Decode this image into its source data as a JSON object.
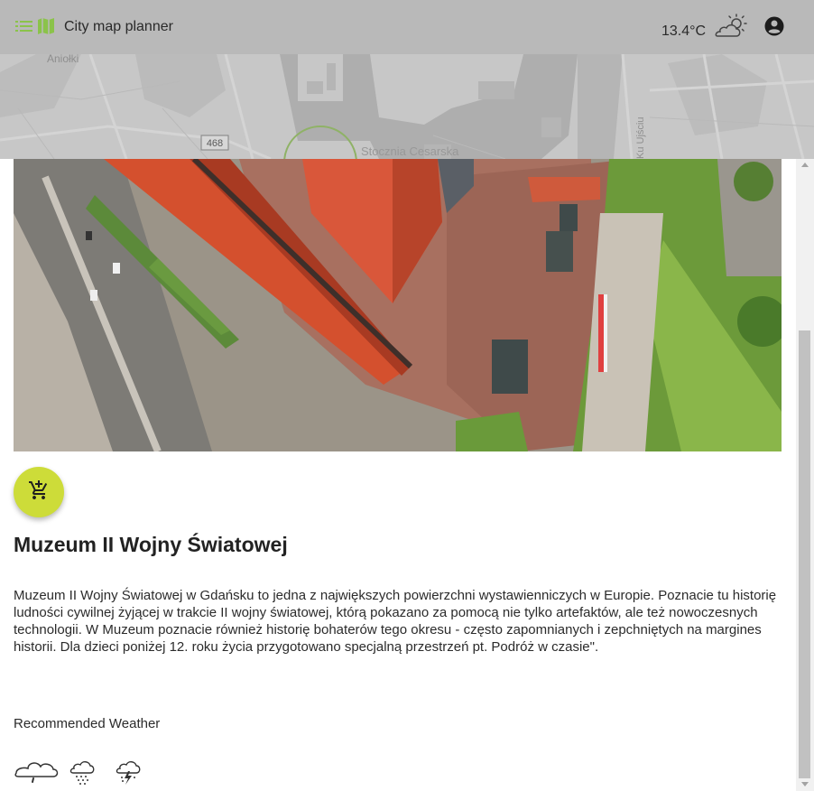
{
  "header": {
    "menu_icon": "menu-list-icon",
    "map_icon": "map-icon",
    "title": "City map planner",
    "temperature": "13.4°C",
    "weather_icon": "partly-sunny-cloud-icon",
    "account_icon": "account-circle-icon",
    "accent_color": "#8bc34a"
  },
  "map": {
    "labels": [
      "Aniołki",
      "468",
      "Stocznia Cesarska",
      "Ku Ujściu"
    ]
  },
  "place": {
    "photo_icon": "museum-aerial-photo",
    "add_to_cart_icon": "add-shopping-cart-icon",
    "fab_color": "#cddc39",
    "title": "Muzeum II Wojny Światowej",
    "description": "Muzeum II Wojny Światowej w Gdańsku to jedna z największych powierzchni wystawienniczych w Europie. Poznacie tu historię ludności cywilnej żyjącej w trakcie II wojny światowej, którą pokazano za pomocą nie tylko artefaktów, ale też nowoczesnych technologii. W Muzeum poznacie również historię bohaterów tego okresu - często zapomnianych i zepchniętych na margines historii. Dla dzieci poniżej 12. roku życia przygotowano specjalną przestrzeń pt. Podróż w czasie\".",
    "recommended_weather_label": "Recommended Weather",
    "recommended_weather_icons": [
      "cloudy-icon",
      "rain-cloud-icon",
      "thunderstorm-cloud-icon"
    ]
  }
}
